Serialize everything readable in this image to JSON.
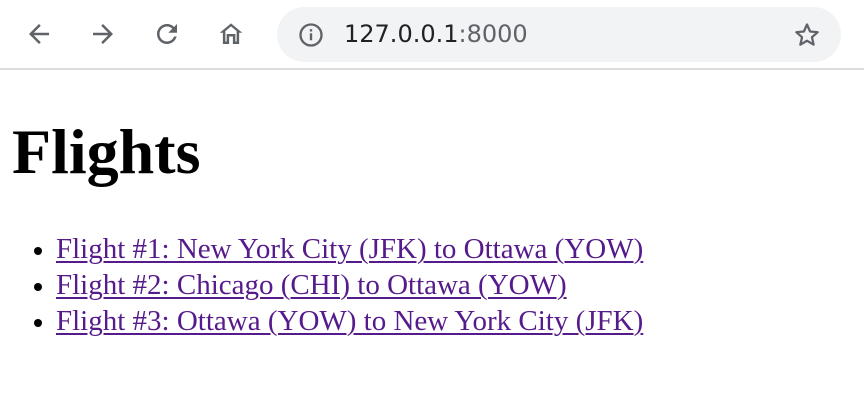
{
  "browser": {
    "url_host": "127.0.0.1",
    "url_port": ":8000",
    "back_icon": "arrow-left-icon",
    "forward_icon": "arrow-right-icon",
    "reload_icon": "reload-icon",
    "home_icon": "home-icon",
    "info_icon": "info-icon",
    "bookmark_icon": "star-icon"
  },
  "page": {
    "title": "Flights",
    "link_color": "#551a8b",
    "flights": [
      {
        "label": "Flight #1: New York City (JFK) to Ottawa (YOW)"
      },
      {
        "label": "Flight #2: Chicago (CHI) to Ottawa (YOW)"
      },
      {
        "label": "Flight #3: Ottawa (YOW) to New York City (JFK)"
      }
    ]
  }
}
